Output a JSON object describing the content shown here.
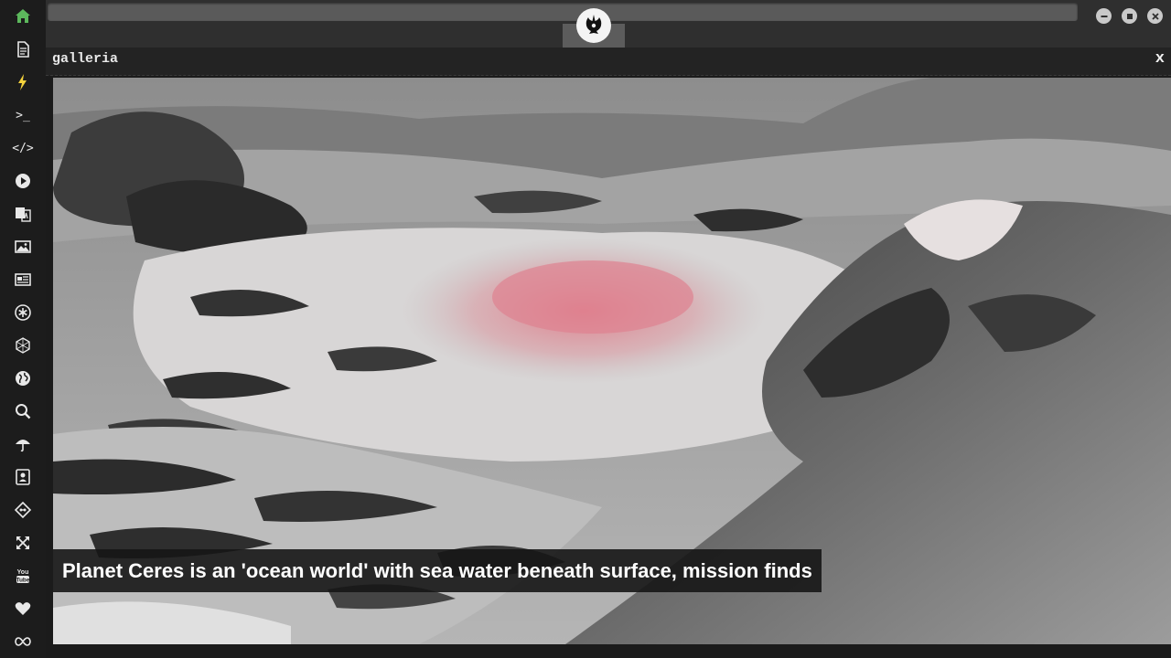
{
  "window": {
    "controls": [
      "minimize-icon",
      "maximize-icon",
      "close-icon"
    ]
  },
  "sidebar": {
    "items": [
      {
        "icon": "home-icon",
        "color": "#5cb85c"
      },
      {
        "icon": "document-icon"
      },
      {
        "icon": "lightning-icon",
        "color": "#f5d33c"
      },
      {
        "icon": "terminal-icon",
        "label": ">_"
      },
      {
        "icon": "code-icon",
        "label": "</>"
      },
      {
        "icon": "play-icon"
      },
      {
        "icon": "translate-icon"
      },
      {
        "icon": "image-icon"
      },
      {
        "icon": "newspaper-icon"
      },
      {
        "icon": "asterisk-icon"
      },
      {
        "icon": "hexagon-icon"
      },
      {
        "icon": "globe-icon"
      },
      {
        "icon": "search-icon"
      },
      {
        "icon": "umbrella-icon"
      },
      {
        "icon": "contact-icon"
      },
      {
        "icon": "git-icon"
      },
      {
        "icon": "expand-icon"
      },
      {
        "icon": "youtube-icon",
        "label": "You Tube"
      },
      {
        "icon": "heart-icon"
      },
      {
        "icon": "infinity-icon"
      }
    ]
  },
  "header": {
    "logo": "rebel-alliance-icon"
  },
  "panel": {
    "title": "galleria",
    "close_label": "x"
  },
  "gallery": {
    "caption": "Planet Ceres is an 'ocean world' with sea water beneath surface, mission finds"
  }
}
